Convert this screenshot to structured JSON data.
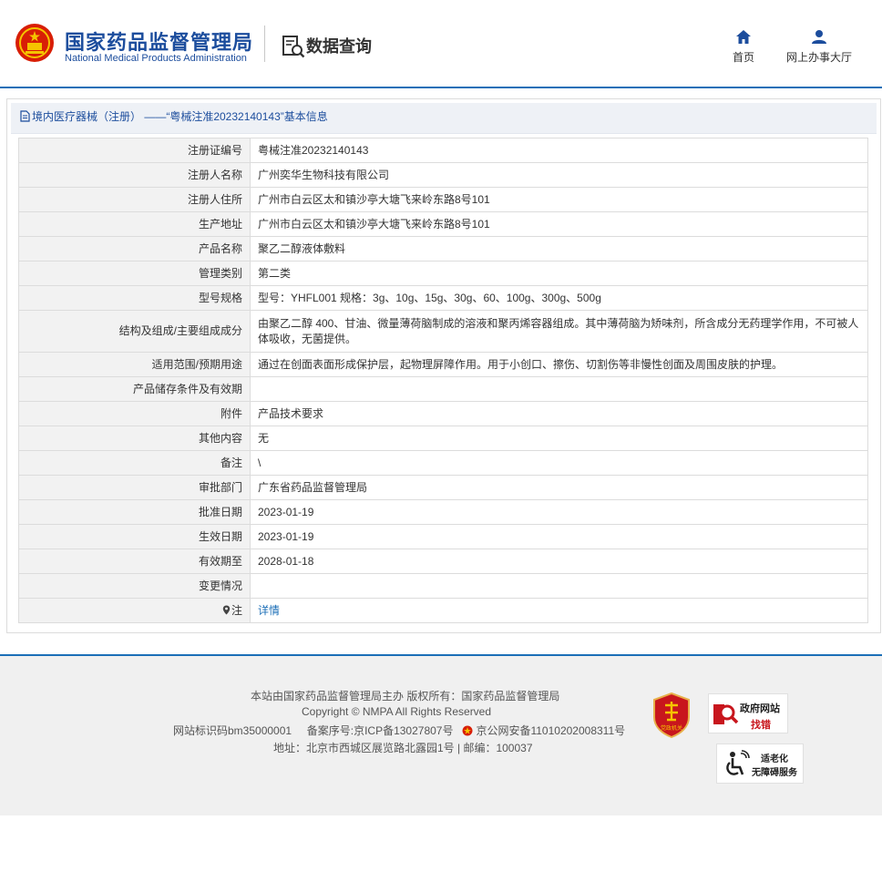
{
  "header": {
    "org_name_cn": "国家药品监督管理局",
    "org_name_en": "National Medical Products Administration",
    "section_title": "数据查询",
    "nav": [
      {
        "label": "首页",
        "icon": "home-icon"
      },
      {
        "label": "网上办事大厅",
        "icon": "user-icon"
      }
    ]
  },
  "panel": {
    "title": "境内医疗器械（注册） ——“粤械注准20232140143”基本信息",
    "rows": [
      {
        "label": "注册证编号",
        "value": "粤械注准20232140143"
      },
      {
        "label": "注册人名称",
        "value": "广州奕华生物科技有限公司"
      },
      {
        "label": "注册人住所",
        "value": "广州市白云区太和镇沙亭大塘飞来岭东路8号101"
      },
      {
        "label": "生产地址",
        "value": "广州市白云区太和镇沙亭大塘飞来岭东路8号101"
      },
      {
        "label": "产品名称",
        "value": "聚乙二醇液体敷料"
      },
      {
        "label": "管理类别",
        "value": "第二类"
      },
      {
        "label": "型号规格",
        "value": "型号：YHFL001 规格：3g、10g、15g、30g、60、100g、300g、500g"
      },
      {
        "label": "结构及组成/主要组成成分",
        "value": "由聚乙二醇 400、甘油、微量薄荷脑制成的溶液和聚丙烯容器组成。其中薄荷脑为矫味剂，所含成分无药理学作用，不可被人体吸收，无菌提供。"
      },
      {
        "label": "适用范围/预期用途",
        "value": "通过在创面表面形成保护层，起物理屏障作用。用于小创口、擦伤、切割伤等非慢性创面及周围皮肤的护理。"
      },
      {
        "label": "产品储存条件及有效期",
        "value": ""
      },
      {
        "label": "附件",
        "value": "产品技术要求"
      },
      {
        "label": "其他内容",
        "value": "无"
      },
      {
        "label": "备注",
        "value": "\\"
      },
      {
        "label": "审批部门",
        "value": "广东省药品监督管理局"
      },
      {
        "label": "批准日期",
        "value": "2023-01-19"
      },
      {
        "label": "生效日期",
        "value": "2023-01-19"
      },
      {
        "label": "有效期至",
        "value": "2028-01-18"
      },
      {
        "label": "变更情况",
        "value": ""
      }
    ],
    "note_label": "注",
    "note_link": "详情"
  },
  "footer": {
    "line1": "本站由国家药品监督管理局主办 版权所有：国家药品监督管理局",
    "line2": "Copyright © NMPA All Rights Reserved",
    "site_id": "网站标识码bm35000001",
    "icp": "备案序号:京ICP备13027807号",
    "police": "京公网安备11010202008311号",
    "address": "地址：北京市西城区展览路北露园1号 | 邮编：100037",
    "party_badge": "党政机关",
    "gov_badge_1": "政府网站",
    "gov_badge_2": "找错",
    "acc_badge_1": "适老化",
    "acc_badge_2": "无障碍服务"
  },
  "colors": {
    "brand_blue": "#1c4d9d",
    "accent_blue": "#1c6fb7",
    "label_bg": "#f2f2f2"
  }
}
